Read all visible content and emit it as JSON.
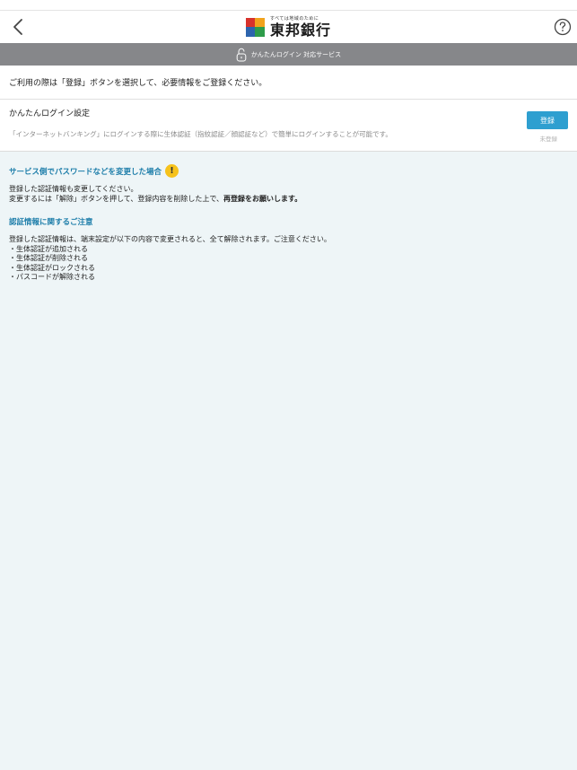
{
  "header": {
    "brand_tagline": "すべては地域のために",
    "brand_name": "東邦銀行",
    "brand_colors": [
      "#d7322c",
      "#f1a21c",
      "#2d64ad",
      "#2e9c4a"
    ]
  },
  "banner": {
    "icon": "lock-icon",
    "text": "かんたんログイン 対応サービス"
  },
  "intro": "ご利用の際は「登録」ボタンを選択して、必要情報をご登録ください。",
  "setting": {
    "title": "かんたんログイン設定",
    "description": "「インターネットバンキング」にログインする際に生体認証（指紋認証／顔認証など）で簡単にログインすることが可能です。",
    "button_label": "登録",
    "status": "未登録"
  },
  "notice1": {
    "heading": "サービス側でパスワードなどを変更した場合",
    "line1": "登録した認証情報も変更してください。",
    "line2_prefix": "変更するには「解除」ボタンを押して、登録内容を削除した上で、",
    "line2_bold": "再登録をお願いします。"
  },
  "notice2": {
    "heading": "認証情報に関するご注意",
    "intro": "登録した認証情報は、端末設定が以下の内容で変更されると、全て解除されます。ご注意ください。",
    "items": [
      "・生体認証が追加される",
      "・生体認証が削除される",
      "・生体認証がロックされる",
      "・パスコードが解除される"
    ]
  },
  "colors": {
    "accent": "#2e9fd0",
    "heading": "#1e7eaa",
    "banner": "#86878a",
    "background": "#eef5f7",
    "warning": "#f6c21c"
  }
}
